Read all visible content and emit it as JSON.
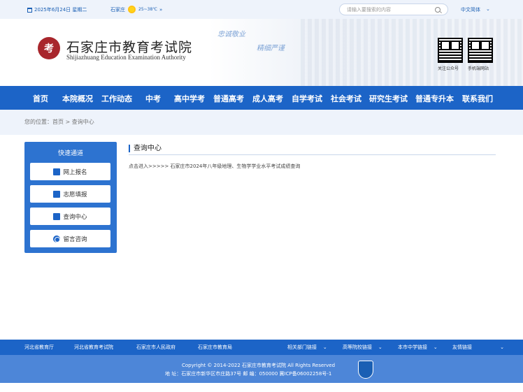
{
  "topbar": {
    "date": "2025年6月24日 星期二",
    "city": "石家庄",
    "temp": "25~38℃",
    "weather_more": "»",
    "search_placeholder": "请输入要搜索的内容",
    "lang": "中文简体",
    "lang_arrow": "⌄"
  },
  "header": {
    "logo_mark": "考",
    "logo_cn": "石家庄市教育考试院",
    "logo_en": "Shijiazhuang Education Examination Authority",
    "slogan1": "忠诚敬业",
    "slogan2": "精细严谨",
    "qr1_label": "关注公众号",
    "qr2_label": "手机端网站"
  },
  "nav": {
    "items": [
      "首页",
      "本院概况",
      "工作动态",
      "中考",
      "高中学考",
      "普通高考",
      "成人高考",
      "自学考试",
      "社会考试",
      "研究生考试",
      "普通专升本",
      "联系我们"
    ]
  },
  "breadcrumb": {
    "text": "您的位置：首页 > 查询中心"
  },
  "sidebar": {
    "title": "快速通道",
    "items": [
      "网上报名",
      "志愿填报",
      "查询中心",
      "留言咨询"
    ]
  },
  "main": {
    "title": "查询中心",
    "link": "点击进入>>>>> 石家庄市2024年八年级地理、生物学学业水平考试成绩查询"
  },
  "links_bar": {
    "links": [
      "河北省教育厅",
      "河北省教育考试院",
      "石家庄市人民政府",
      "石家庄市教育局"
    ],
    "dropdowns": [
      "相关部门链接",
      "高等院校链接",
      "本市中学链接",
      "友情链接"
    ],
    "arrow": "⌄"
  },
  "footer": {
    "copyright": "Copyright © 2014-2022 石家庄市教育考试院 All Rights Reserved",
    "address": "地 址：石家庄市新华区市庄路37号   邮 编：050000   冀ICP备06002258号-1"
  }
}
